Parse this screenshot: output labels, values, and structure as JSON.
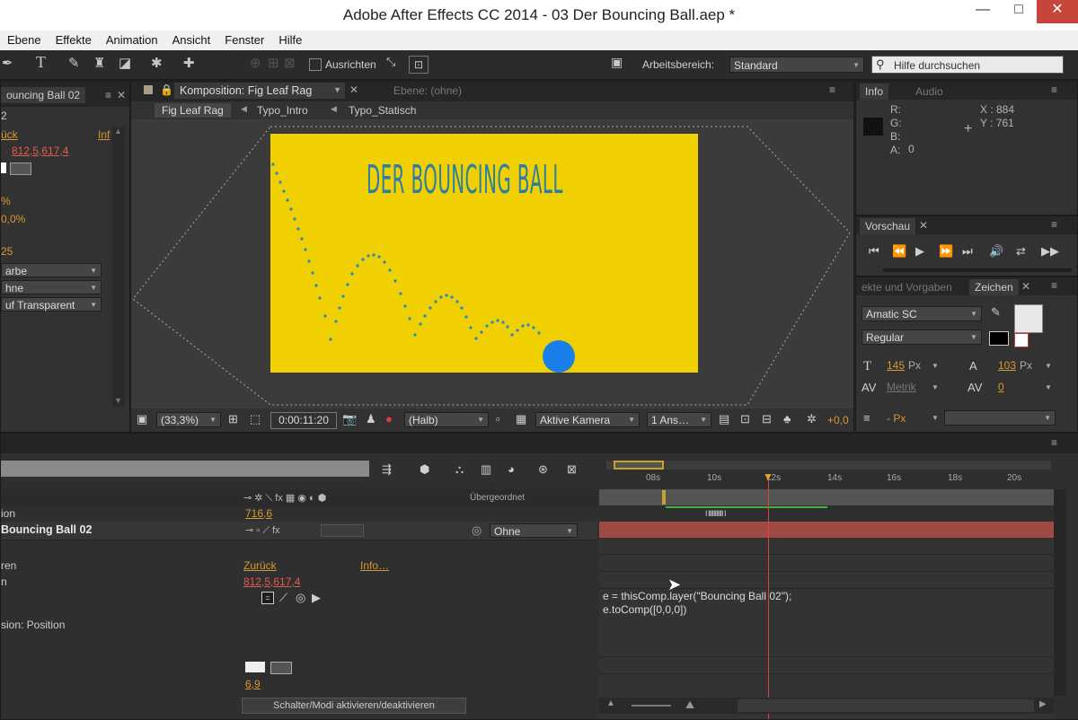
{
  "window": {
    "title": "Adobe After Effects CC 2014 - 03 Der Bouncing Ball.aep *",
    "min": "—",
    "max": "□",
    "close": "✕"
  },
  "menu": [
    "Ebene",
    "Effekte",
    "Animation",
    "Ansicht",
    "Fenster",
    "Hilfe"
  ],
  "toolbar": {
    "align_label": "Ausrichten",
    "workspace_label": "Arbeitsbereich:",
    "workspace_value": "Standard",
    "search_placeholder": "Hilfe durchsuchen"
  },
  "left_panel": {
    "header": "ouncing Ball 02",
    "row2": "2",
    "reset": "ück",
    "info": "Inf",
    "position": "812,5,617,4",
    "scale": "%",
    "rotation": "0,0%",
    "opacity": "25",
    "dd1": "arbe",
    "dd2": "hne",
    "dd3": "uf Transparent"
  },
  "composition": {
    "tab_label": "Komposition: Fig Leaf Rag",
    "layer_tab": "Ebene: (ohne)",
    "breadcrumbs": [
      "Fig Leaf Rag",
      "Typo_Intro",
      "Typo_Statisch"
    ],
    "canvas_title": "DER BOUNCING BALL",
    "canvas_bg": "#f0d000",
    "ball_color": "#1a7fe8",
    "zoom": "(33,3%)",
    "timecode": "0:00:11:20",
    "resolution": "(Halb)",
    "camera": "Aktive Kamera",
    "views": "1 Ans…",
    "exposure": "+0,0"
  },
  "info_panel": {
    "tab_info": "Info",
    "tab_audio": "Audio",
    "r": "R:",
    "g": "G:",
    "b": "B:",
    "a": "A:",
    "a_val": "0",
    "x": "X : 884",
    "y": "Y : 761"
  },
  "preview_panel": {
    "tab": "Vorschau"
  },
  "character_panel": {
    "tab_effects": "ekte und Vorgaben",
    "tab_char": "Zeichen",
    "font": "Amatic SC",
    "style": "Regular",
    "size": "145",
    "size_unit": "Px",
    "leading": "103",
    "leading_unit": "Px",
    "kerning": "Metrik",
    "tracking": "0",
    "stroke": "- Px"
  },
  "timeline": {
    "parent_header": "Übergeordnet",
    "layer_name": "Bouncing Ball 02",
    "parent_value": "Ohne",
    "row_ion": "ion",
    "row_ion_val": "716,6",
    "row_ren": "ren",
    "reset": "Zurück",
    "info": "Info…",
    "row_n": "n",
    "position_val": "812,5,617,4",
    "expression_label": "sion: Position",
    "expr_line1": "e = thisComp.layer(\"Bouncing Ball 02\");",
    "expr_line2": "e.toComp([0,0,0])",
    "bottom_val": "6,9",
    "switch_btn": "Schalter/Modi aktivieren/deaktivieren",
    "ticks": [
      "08s",
      "10s",
      "12s",
      "14s",
      "16s",
      "18s",
      "20s"
    ]
  }
}
